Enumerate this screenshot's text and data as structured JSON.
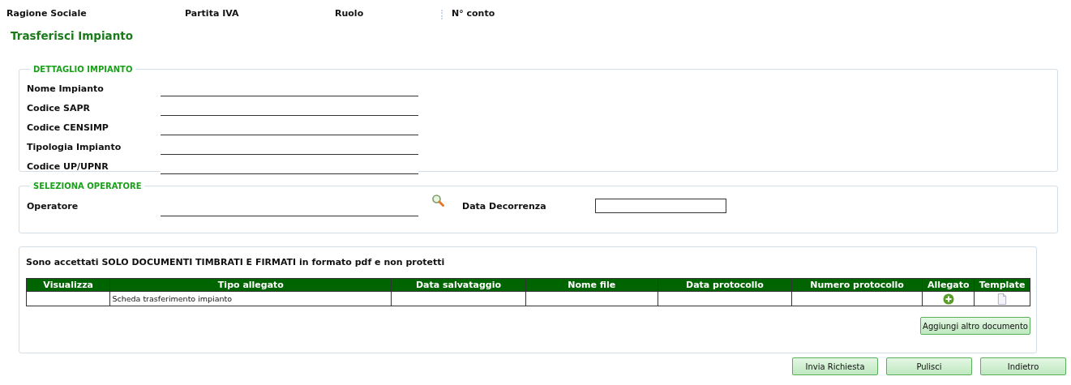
{
  "header": [
    "Ragione Sociale",
    "Partita IVA",
    "Ruolo",
    "N° conto"
  ],
  "title": "Trasferisci Impianto",
  "detail": {
    "legend": "DETTAGLIO IMPIANTO",
    "fields": [
      {
        "label": "Nome Impianto"
      },
      {
        "label": "Codice SAPR"
      },
      {
        "label": "Codice CENSIMP"
      },
      {
        "label": "Tipologia Impianto"
      },
      {
        "label": "Codice UP/UPNR"
      }
    ]
  },
  "operator": {
    "legend": "SELEZIONA OPERATORE",
    "label": "Operatore",
    "date_label": "Data Decorrenza"
  },
  "documents": {
    "note": "Sono accettati SOLO DOCUMENTI TIMBRATI E FIRMATI in formato pdf e non protetti",
    "columns": [
      "Visualizza",
      "Tipo allegato",
      "Data salvataggio",
      "Nome file",
      "Data protocollo",
      "Numero protocollo",
      "Allegato",
      "Template"
    ],
    "rows": [
      {
        "tipo_allegato": "Scheda trasferimento impianto"
      }
    ],
    "add_button": "Aggiungi altro documento"
  },
  "buttons": [
    "Invia Richiesta",
    "Pulisci",
    "Indietro"
  ]
}
